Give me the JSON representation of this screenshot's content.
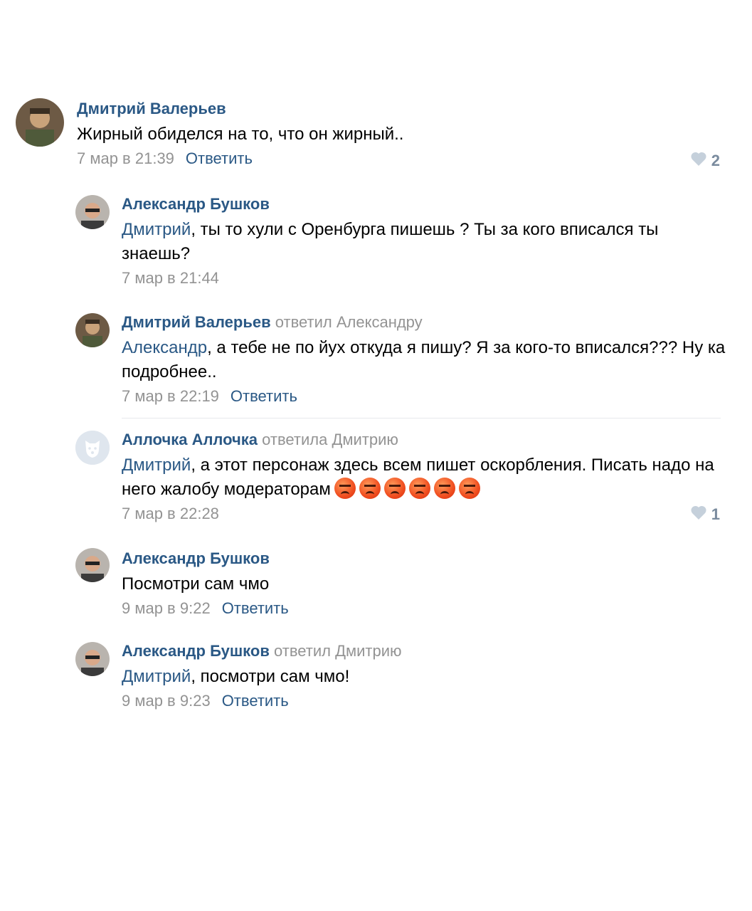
{
  "comments": [
    {
      "author": "Дмитрий Валерьев",
      "replied": "",
      "mention": "",
      "text": "Жирный обиделся на то, что он жирный..",
      "date": "7 мар в 21:39",
      "reply_label": "Ответить",
      "likes": "2"
    },
    {
      "author": "Александр Бушков",
      "replied": "",
      "mention": "Дмитрий",
      "text": ", ты то хули с Оренбурга пишешь ? Ты за кого вписался ты знаешь?",
      "date": "7 мар в 21:44",
      "reply_label": "",
      "likes": ""
    },
    {
      "author": "Дмитрий Валерьев",
      "replied": "ответил Александру",
      "mention": "Александр",
      "text": ", а тебе не по йух откуда я пишу? Я за кого-то вписался??? Ну ка подробнее..",
      "date": "7 мар в 22:19",
      "reply_label": "Ответить",
      "likes": ""
    },
    {
      "author": "Аллочка Аллочка",
      "replied": "ответила Дмитрию",
      "mention": "Дмитрий",
      "text": ", а этот персонаж здесь всем пишет оскорбления. Писать надо на него жалобу модераторам",
      "emoji": "😡😡😡😡😡😡",
      "date": "7 мар в 22:28",
      "reply_label": "",
      "likes": "1"
    },
    {
      "author": "Александр Бушков",
      "replied": "",
      "mention": "",
      "text": "Посмотри сам чмо",
      "date": "9 мар в 9:22",
      "reply_label": "Ответить",
      "likes": ""
    },
    {
      "author": "Александр Бушков",
      "replied": "ответил Дмитрию",
      "mention": "Дмитрий",
      "text": ", посмотри сам чмо!",
      "date": "9 мар в 9:23",
      "reply_label": "Ответить",
      "likes": ""
    }
  ],
  "colors": {
    "link": "#2a5885",
    "muted": "#939393",
    "like_icon": "#c5d0db"
  }
}
